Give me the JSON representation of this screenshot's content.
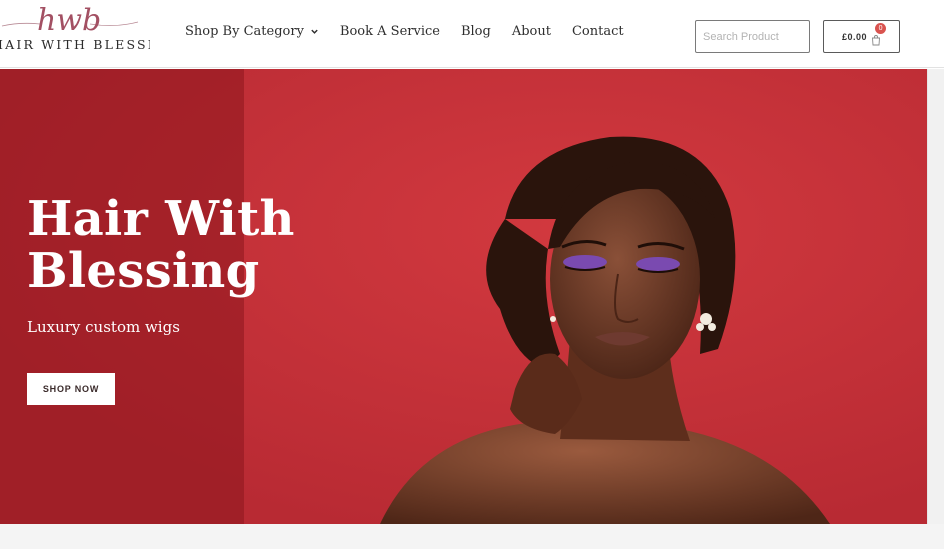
{
  "logo": {
    "script_text": "hwb",
    "text": "HAIR WITH BLESSING"
  },
  "nav": {
    "items": [
      {
        "label": "Shop By Category",
        "has_dropdown": true
      },
      {
        "label": "Book A Service"
      },
      {
        "label": "Blog"
      },
      {
        "label": "About"
      },
      {
        "label": "Contact"
      }
    ]
  },
  "search": {
    "placeholder": "Search Product",
    "value": ""
  },
  "cart": {
    "amount": "£0.00",
    "count": "0"
  },
  "hero": {
    "title": "Hair With\nBlessing",
    "subtitle": "Luxury custom wigs",
    "cta_label": "SHOP NOW"
  },
  "colors": {
    "hero_red": "#c7313a",
    "overlay_red": "#8c161e",
    "badge_red": "#d9534f",
    "logo_accent": "#b05a6a"
  },
  "icons": [
    "chevron-down-icon",
    "cart-icon"
  ]
}
